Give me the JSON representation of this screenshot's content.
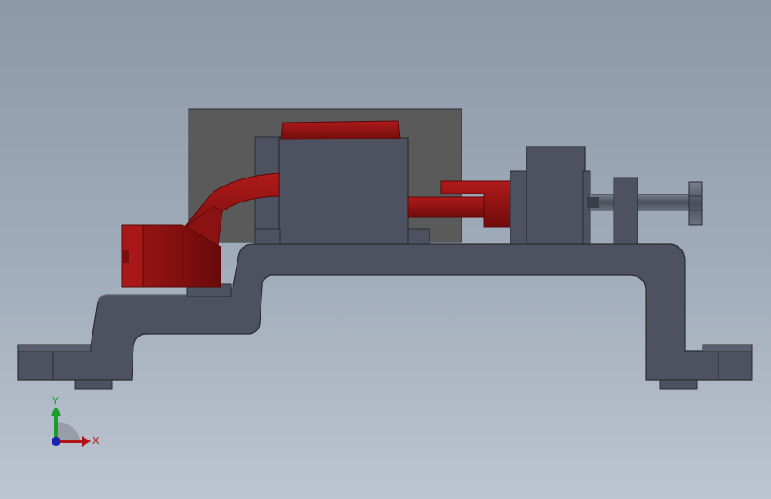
{
  "viewport": {
    "background_top": "#8c98a8",
    "background_bottom": "#bcc5d0"
  },
  "model": {
    "body_color": "#4e5260",
    "body_edge": "#2a2c33",
    "plate_color": "#5a5a5a",
    "clamp_color": "#9c1616",
    "clamp_dark": "#6e0c0c",
    "bolt_color": "#5e6472"
  },
  "triad": {
    "x_label": "X",
    "y_label": "Y",
    "x_color": "#b01414",
    "y_color": "#1a9c2a",
    "z_color": "#1a24b0"
  }
}
